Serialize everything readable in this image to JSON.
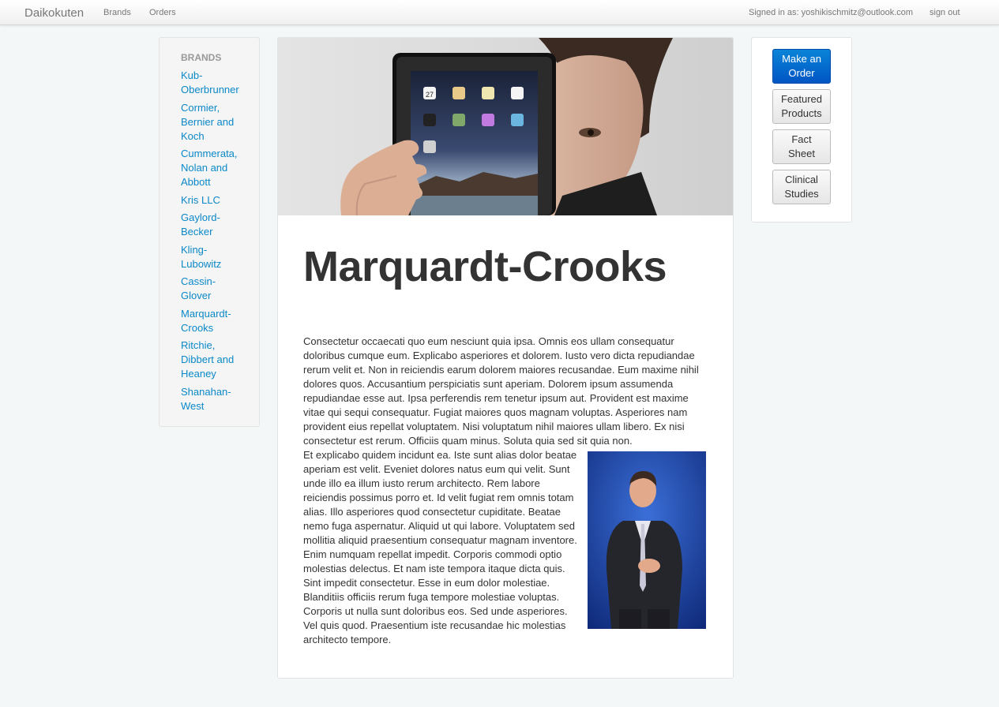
{
  "navbar": {
    "brand": "Daikokuten",
    "links": [
      "Brands",
      "Orders"
    ],
    "signed_in": "Signed in as: yoshikischmitz@outlook.com",
    "sign_out": "sign out"
  },
  "sidebar": {
    "header": "BRANDS",
    "items": [
      "Kub-Oberbrunner",
      "Cormier, Bernier and Koch",
      "Cummerata, Nolan and Abbott",
      "Kris LLC",
      "Gaylord-Becker",
      "Kling-Lubowitz",
      "Cassin-Glover",
      "Marquardt-Crooks",
      "Ritchie, Dibbert and Heaney",
      "Shanahan-West"
    ]
  },
  "main": {
    "title": "Marquardt-Crooks",
    "paragraph1": "Consectetur occaecati quo eum nesciunt quia ipsa. Omnis eos ullam consequatur doloribus cumque eum. Explicabo asperiores et dolorem. Iusto vero dicta repudiandae rerum velit et. Non in reiciendis earum dolorem maiores recusandae. Eum maxime nihil dolores quos. Accusantium perspiciatis sunt aperiam. Dolorem ipsum assumenda repudiandae esse aut. Ipsa perferendis rem tenetur ipsum aut. Provident est maxime vitae qui sequi consequatur. Fugiat maiores quos magnam voluptas. Asperiores nam provident eius repellat voluptatem. Nisi voluptatum nihil maiores ullam libero. Ex nisi consectetur est rerum. Officiis quam minus. Soluta quia sed sit quia non.",
    "paragraph2": "Et explicabo quidem incidunt ea. Iste sunt alias dolor beatae aperiam est velit. Eveniet dolores natus eum qui velit. Sunt unde illo ea illum iusto rerum architecto. Rem labore reiciendis possimus porro et. Id velit fugiat rem omnis totam alias. Illo asperiores quod consectetur cupiditate. Beatae nemo fuga aspernatur. Aliquid ut qui labore. Voluptatem sed mollitia aliquid praesentium consequatur magnam inventore. Enim numquam repellat impedit. Corporis commodi optio molestias delectus. Et nam iste tempora itaque dicta quis. Sint impedit consectetur. Esse in eum dolor molestiae. Blanditiis officiis rerum fuga tempore molestiae voluptas. Corporis ut nulla sunt doloribus eos. Sed unde asperiores. Vel quis quod. Praesentium iste recusandae hic molestias architecto tempore."
  },
  "actions": {
    "make_order": "Make an Order",
    "featured": "Featured Products",
    "fact_sheet": "Fact Sheet",
    "clinical": "Clinical Studies"
  },
  "hero_tablet_date": "27"
}
